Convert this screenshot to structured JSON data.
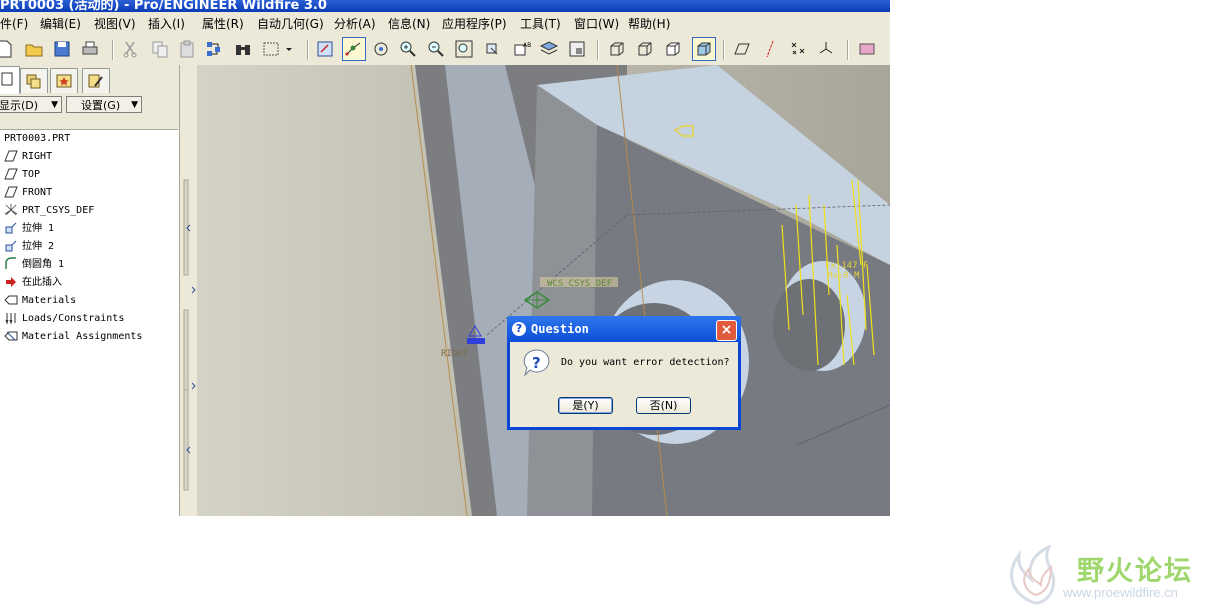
{
  "window": {
    "title": "PRT0003 (活动的) - Pro/ENGINEER Wildfire 3.0"
  },
  "menubar": {
    "items": [
      {
        "label": "件(F)"
      },
      {
        "label": "编辑(E)"
      },
      {
        "label": "视图(V)"
      },
      {
        "label": "插入(I)"
      },
      {
        "label": "属性(R)"
      },
      {
        "label": "自动几何(G)"
      },
      {
        "label": "分析(A)"
      },
      {
        "label": "信息(N)"
      },
      {
        "label": "应用程序(P)"
      },
      {
        "label": "工具(T)"
      },
      {
        "label": "窗口(W)"
      },
      {
        "label": "帮助(H)"
      }
    ]
  },
  "toolbar": {
    "icons": [
      "new-file-icon",
      "open-folder-icon",
      "save-icon",
      "print-icon",
      "cut-icon",
      "copy-icon",
      "paste-icon",
      "regenerate-icon",
      "find-binoculars-icon",
      "select-box-icon",
      "dropdown-arrow-icon",
      "repaint-icon",
      "spin-center-icon",
      "orient-mode-icon",
      "zoom-in-icon",
      "zoom-out-icon",
      "refit-icon",
      "reorient-icon",
      "saved-views-icon",
      "layers-icon",
      "view-manager-icon",
      "wireframe-icon",
      "hidden-line-icon",
      "no-hidden-icon",
      "shading-icon",
      "datum-planes-icon",
      "datum-axes-icon",
      "datum-points-icon",
      "csys-icon",
      "appearance-icon"
    ]
  },
  "sidepanel": {
    "show_dropdown": "显示(D)",
    "settings_dropdown": "设置(G)",
    "tree": [
      {
        "label": "PRT0003.PRT",
        "icon": "part-icon"
      },
      {
        "label": "RIGHT",
        "icon": "datum-plane-icon"
      },
      {
        "label": "TOP",
        "icon": "datum-plane-icon"
      },
      {
        "label": "FRONT",
        "icon": "datum-plane-icon"
      },
      {
        "label": "PRT_CSYS_DEF",
        "icon": "coordinate-system-icon"
      },
      {
        "label": "拉伸 1",
        "icon": "extrude-icon"
      },
      {
        "label": "拉伸 2",
        "icon": "extrude-icon"
      },
      {
        "label": "倒圆角 1",
        "icon": "round-icon"
      },
      {
        "label": "在此插入",
        "icon": "insert-here-arrow-icon"
      },
      {
        "label": "Materials",
        "icon": "materials-icon"
      },
      {
        "label": "Loads/Constraints",
        "icon": "loads-icon"
      },
      {
        "label": "Material Assignments",
        "icon": "material-assign-icon"
      }
    ]
  },
  "viewport": {
    "labels": {
      "wcs": "WCS_CSYS_DEF",
      "right": "RIGHT",
      "force_label": "Fx:147 F",
      "moment_label": "Mx:0 M"
    }
  },
  "dialog": {
    "title": "Question",
    "message": "Do you want error detection?",
    "yes_button": "是(Y)",
    "no_button": "否(N)"
  },
  "watermark": {
    "text": "野火论坛",
    "url": "www.proewildfire.cn"
  }
}
